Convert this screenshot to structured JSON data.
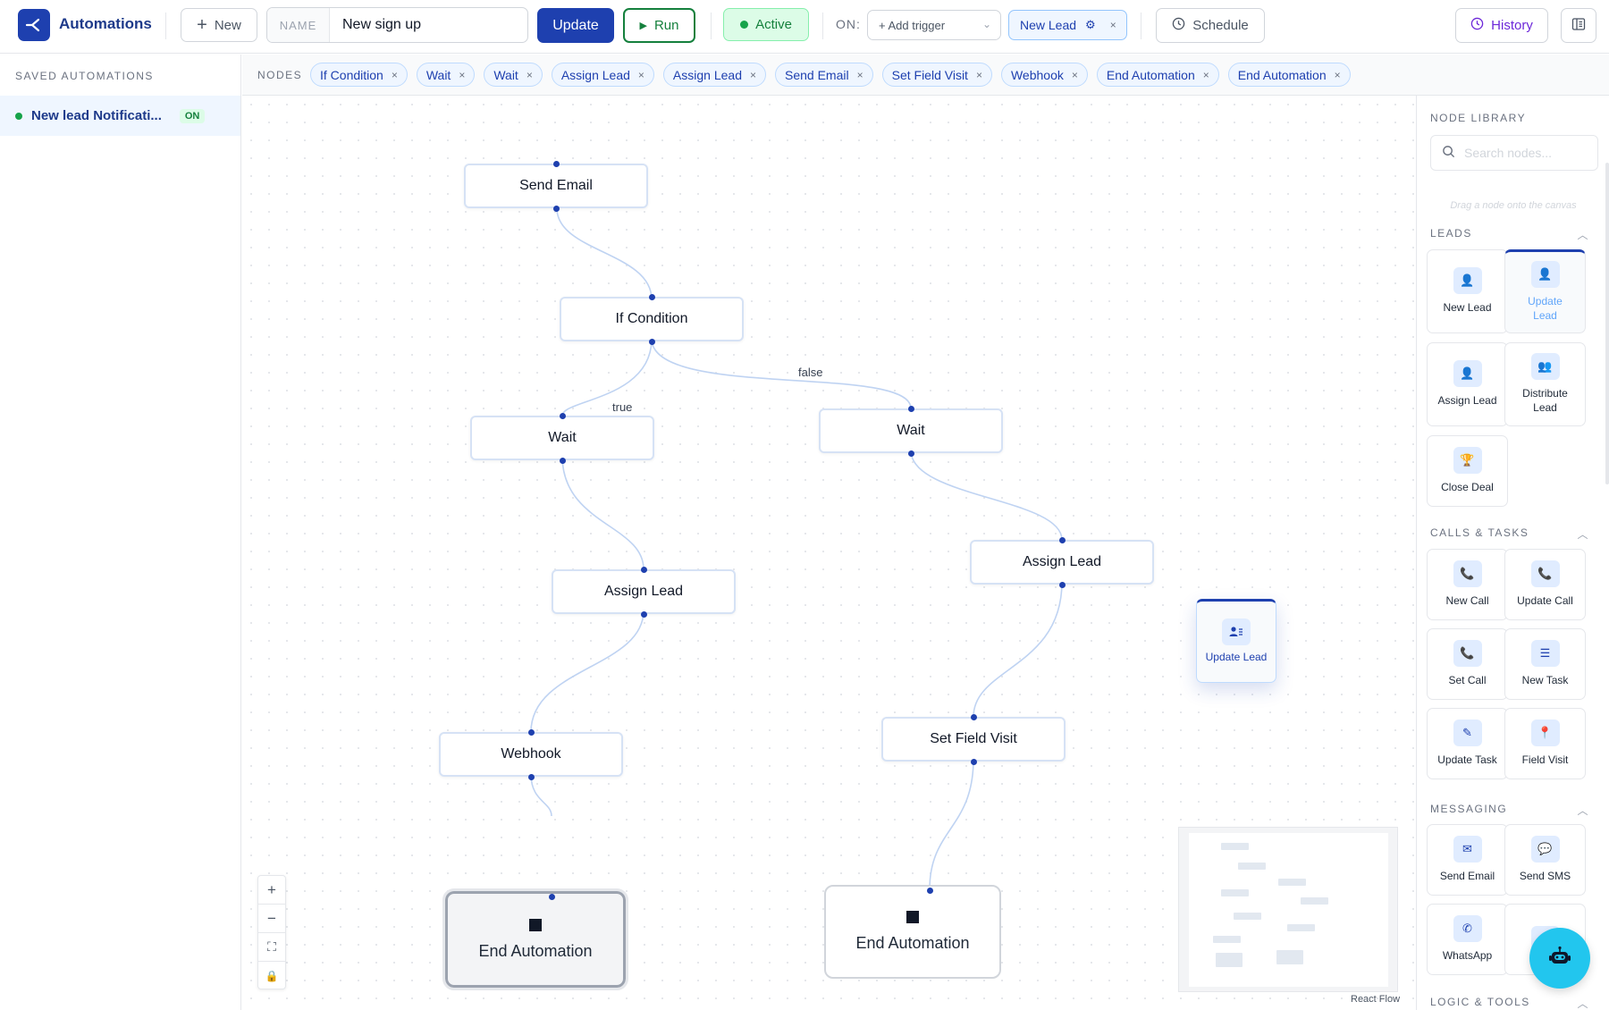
{
  "header": {
    "brand": "Automations",
    "new_label": "New",
    "name_label": "NAME",
    "name_value": "New sign up",
    "update_label": "Update",
    "run_label": "Run",
    "active_label": "Active",
    "on_label": "ON:",
    "add_trigger_label": "+ Add trigger",
    "trigger_chip": "New Lead",
    "schedule_label": "Schedule",
    "history_label": "History"
  },
  "sidebar": {
    "heading": "SAVED AUTOMATIONS",
    "items": [
      {
        "label": "New lead Notificati...",
        "badge": "ON"
      }
    ]
  },
  "nodes_strip": {
    "label": "NODES",
    "chips": [
      "If Condition",
      "Wait",
      "Wait",
      "Assign Lead",
      "Assign Lead",
      "Send Email",
      "Set Field Visit",
      "Webhook",
      "End Automation",
      "End Automation"
    ]
  },
  "canvas": {
    "nodes": {
      "send_email": "Send Email",
      "if_condition": "If Condition",
      "wait_true": "Wait",
      "wait_false": "Wait",
      "assign_lead_left": "Assign Lead",
      "assign_lead_right": "Assign Lead",
      "webhook": "Webhook",
      "set_field_visit": "Set Field Visit",
      "end_left": "End Automation",
      "end_right": "End Automation"
    },
    "edge_labels": {
      "true": "true",
      "false": "false"
    },
    "dragging_node": "Update Lead",
    "attribution": "React Flow",
    "controls": [
      "+",
      "−",
      "⛶",
      "🔒"
    ]
  },
  "library": {
    "heading": "NODE LIBRARY",
    "search_placeholder": "Search nodes...",
    "hint": "Drag a node onto the canvas",
    "sections": {
      "leads": {
        "title": "LEADS",
        "items": [
          "New Lead",
          "Update Lead",
          "Assign Lead",
          "Distribute Lead",
          "Close Deal"
        ]
      },
      "calls": {
        "title": "CALLS & TASKS",
        "items": [
          "New Call",
          "Update Call",
          "Set Call",
          "New Task",
          "Update Task",
          "Field Visit"
        ]
      },
      "messaging": {
        "title": "MESSAGING",
        "items": [
          "Send Email",
          "Send SMS",
          "WhatsApp"
        ]
      },
      "logic": {
        "title": "LOGIC & TOOLS"
      }
    }
  },
  "colors": {
    "primary": "#1e40af",
    "active_green": "#15803d",
    "history_purple": "#6d28d9",
    "bot_cyan": "#22c6ee"
  }
}
